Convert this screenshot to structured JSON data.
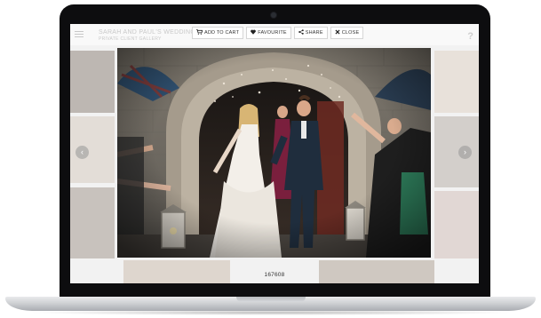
{
  "app": {
    "site_title": "SARAH AND PAUL'S WEDDING",
    "site_subtitle": "PRIVATE CLIENT GALLERY"
  },
  "toolbar": {
    "add_to_cart": {
      "label": "ADD TO CART",
      "icon": "cart-icon"
    },
    "favourite": {
      "label": "FAVOURITE",
      "icon": "heart-icon"
    },
    "share": {
      "label": "SHARE",
      "icon": "share-icon"
    },
    "close": {
      "label": "CLOSE",
      "icon": "close-icon"
    }
  },
  "help_glyph": "?",
  "navigation": {
    "prev_glyph": "‹",
    "next_glyph": "›"
  },
  "photo": {
    "id": "167608",
    "subject": "wedding couple exiting church"
  },
  "colors": {
    "bezel": "#0d0d0f",
    "screen_bg": "#f2f2f2",
    "toolbar_button_bg": "#ffffff",
    "stone": "#8f887c",
    "dress": "#f3efe9",
    "suit": "#1f2d3d"
  }
}
